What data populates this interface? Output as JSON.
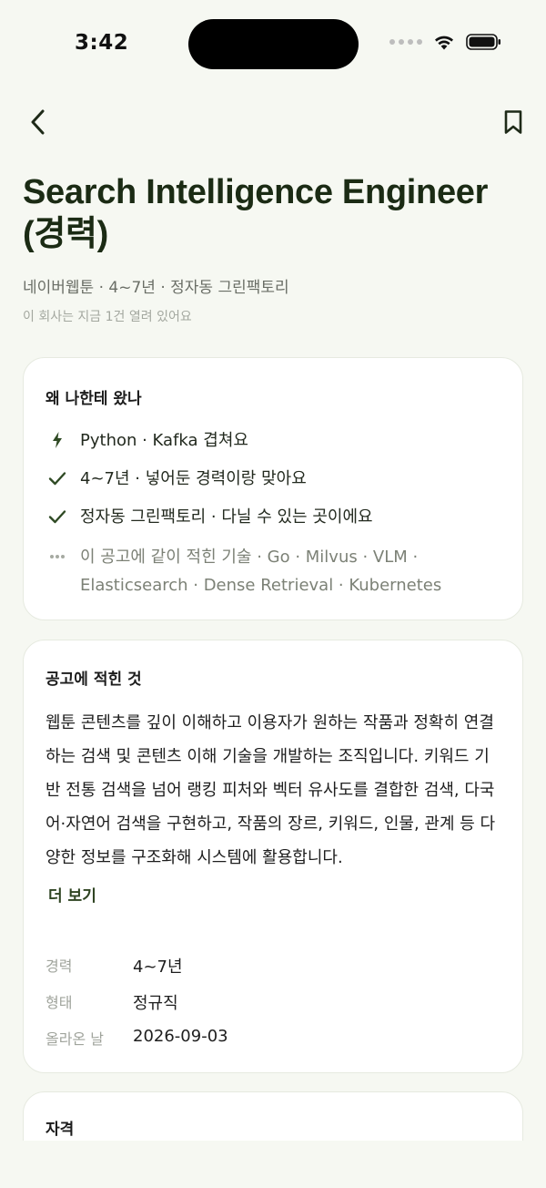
{
  "status_bar": {
    "time": "3:42"
  },
  "job": {
    "title": "Search Intelligence Engineer (경력)",
    "meta": "네이버웹툰 · 4~7년 · 정자동 그린팩토리",
    "submeta": "이 회사는 지금 1건 열려 있어요"
  },
  "why_card": {
    "title": "왜 나한테 왔나",
    "reasons": [
      {
        "icon": "bolt-icon",
        "text": "Python · Kafka 겹쳐요"
      },
      {
        "icon": "check-icon",
        "text": "4~7년 · 넣어둔 경력이랑 맞아요"
      },
      {
        "icon": "check-icon",
        "text": "정자동 그린팩토리 · 다닐 수 있는 곳이에요"
      },
      {
        "icon": "more-dots-icon",
        "text": "이 공고에 같이 적힌 기술 · Go · Milvus · VLM · Elasticsearch · Dense Retrieval · Kubernetes"
      }
    ]
  },
  "posting_card": {
    "title": "공고에 적힌 것",
    "description": "웹툰 콘텐츠를 깊이 이해하고 이용자가 원하는 작품과 정확히 연결하는 검색 및 콘텐츠 이해 기술을 개발하는 조직입니다. 키워드 기반 전통 검색을 넘어 랭킹 피처와 벡터 유사도를 결합한 검색, 다국어·자연어 검색을 구현하고, 작품의 장르, 키워드, 인물, 관계 등 다양한 정보를 구조화해 시스템에 활용합니다.",
    "more_label": "더 보기",
    "info": [
      {
        "key": "경력",
        "value": "4~7년"
      },
      {
        "key": "형태",
        "value": "정규직"
      },
      {
        "key": "올라온 날",
        "value": "2026-09-03"
      }
    ]
  },
  "qualifications_card": {
    "title": "자격"
  },
  "colors": {
    "accent": "#2f4422",
    "background": "#f6f8f2",
    "card": "#ffffff"
  }
}
